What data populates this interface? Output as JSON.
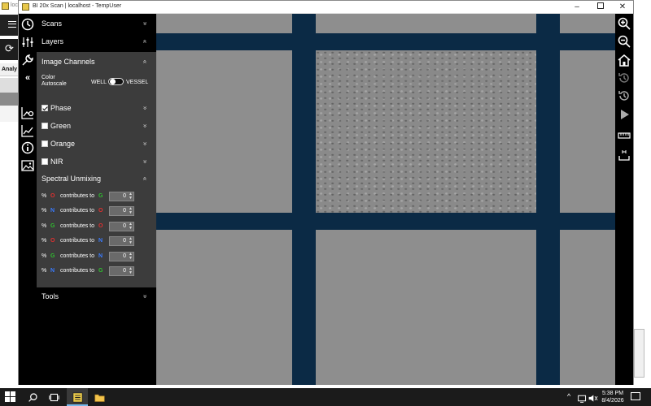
{
  "background_app": {
    "title_fragment": "loc",
    "tab_fragment": "Analy"
  },
  "window": {
    "title": "BI 20x Scan | localhost - TempUser",
    "controls": {
      "minimize": "–",
      "close": "✕"
    }
  },
  "left_rail": {
    "icons": [
      "clock-icon",
      "sliders-icon",
      "wrench-icon",
      "collapse-icon",
      "chart-settings-icon",
      "line-chart-icon",
      "info-icon",
      "image-icon"
    ],
    "collapse_glyph": "«"
  },
  "panel": {
    "scans": {
      "label": "Scans",
      "chevron": "»"
    },
    "layers": {
      "label": "Layers",
      "chevron": "»"
    },
    "image_channels": {
      "label": "Image Channels",
      "chevron": "»",
      "color_autoscale": {
        "label": "Color Autoscale",
        "left_option": "WELL",
        "right_option": "VESSEL",
        "selected": "WELL"
      },
      "channels": [
        {
          "name": "Phase",
          "checked": true,
          "chevron": "»"
        },
        {
          "name": "Green",
          "checked": false,
          "chevron": "»"
        },
        {
          "name": "Orange",
          "checked": false,
          "chevron": "»"
        },
        {
          "name": "NIR",
          "checked": false,
          "chevron": "»"
        }
      ]
    },
    "spectral_unmixing": {
      "label": "Spectral Unmixing",
      "chevron": "»",
      "rows": [
        {
          "pct": "%",
          "source": "O",
          "source_color": "#e03030",
          "text": "contributes to",
          "target": "G",
          "target_color": "#2fbf2f",
          "value": "0"
        },
        {
          "pct": "%",
          "source": "N",
          "source_color": "#3a7bff",
          "text": "contributes to",
          "target": "O",
          "target_color": "#e03030",
          "value": "0"
        },
        {
          "pct": "%",
          "source": "G",
          "source_color": "#2fbf2f",
          "text": "contributes to",
          "target": "O",
          "target_color": "#e03030",
          "value": "0"
        },
        {
          "pct": "%",
          "source": "O",
          "source_color": "#e03030",
          "text": "contributes to",
          "target": "N",
          "target_color": "#3a7bff",
          "value": "0"
        },
        {
          "pct": "%",
          "source": "G",
          "source_color": "#2fbf2f",
          "text": "contributes to",
          "target": "N",
          "target_color": "#3a7bff",
          "value": "0"
        },
        {
          "pct": "%",
          "source": "N",
          "source_color": "#3a7bff",
          "text": "contributes to",
          "target": "G",
          "target_color": "#2fbf2f",
          "value": "0"
        }
      ]
    },
    "tools": {
      "label": "Tools",
      "chevron": "»"
    }
  },
  "right_toolbar": {
    "icons": [
      "zoom-in-icon",
      "zoom-out-icon",
      "home-icon",
      "history-icon",
      "restore-icon",
      "play-icon",
      "ruler-icon",
      "scale-bar-icon"
    ]
  },
  "colors": {
    "viewer_background": "#0b2a45",
    "panel_background": "#000000",
    "subpanel_background": "#3c3c3c"
  },
  "taskbar": {
    "time": "5:38 PM",
    "date": "8/4/2026"
  }
}
